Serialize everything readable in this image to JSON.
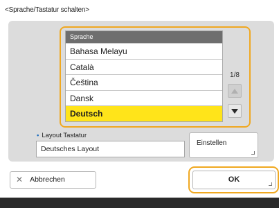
{
  "dialog": {
    "title": "<Sprache/Tastatur schalten>"
  },
  "language_list": {
    "header": "Sprache",
    "items": [
      "Bahasa Melayu",
      "Català",
      "Čeština",
      "Dansk",
      "Deutsch"
    ],
    "selected": "Deutsch",
    "page_indicator": "1/8",
    "selected_color": "#ffe41a"
  },
  "keyboard_layout": {
    "label": "Layout Tastatur",
    "value": "Deutsches Layout",
    "settings_button": "Einstellen"
  },
  "buttons": {
    "cancel": "Abbrechen",
    "ok": "OK"
  },
  "icons": {
    "bullet": "bullet-icon",
    "scroll_up": "triangle-up-icon",
    "scroll_down": "triangle-down-icon",
    "cancel": "x-icon"
  },
  "colors": {
    "focus_border": "#f0a820",
    "panel": "#dcdcdc",
    "header": "#6e6e6e",
    "bottom_bar": "#2a2a2a"
  }
}
